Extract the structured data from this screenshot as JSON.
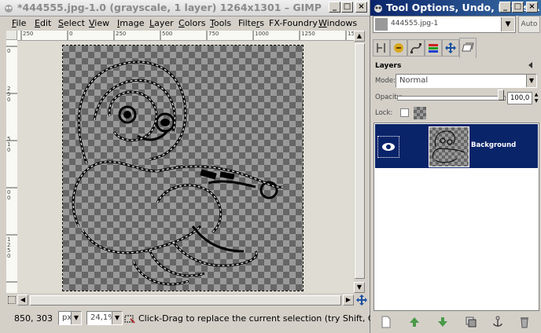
{
  "main_window": {
    "title": "*444555.jpg-1.0 (grayscale, 1 layer) 1264x1301 – GIMP",
    "title_buttons": [
      "_",
      "□",
      "×"
    ]
  },
  "menu": {
    "items": [
      {
        "label": "File",
        "mnemonic": "F"
      },
      {
        "label": "Edit",
        "mnemonic": "E"
      },
      {
        "label": "Select",
        "mnemonic": "S"
      },
      {
        "label": "View",
        "mnemonic": "V"
      },
      {
        "label": "Image",
        "mnemonic": "I"
      },
      {
        "label": "Layer",
        "mnemonic": "L"
      },
      {
        "label": "Colors",
        "mnemonic": "C"
      },
      {
        "label": "Tools",
        "mnemonic": "T"
      },
      {
        "label": "Filters",
        "mnemonic": "r"
      },
      {
        "label": "FX-Foundry",
        "mnemonic": ""
      },
      {
        "label": "Windows",
        "mnemonic": "W"
      }
    ]
  },
  "ruler": {
    "h_ticks": [
      "250",
      "0",
      "250",
      "500",
      "750",
      "1000",
      "1250",
      "1500"
    ],
    "v_ticks": [
      "0",
      "2",
      "5",
      "0",
      "5",
      "1",
      "0",
      "0",
      "0",
      "1",
      "2",
      "5",
      "0"
    ]
  },
  "statusbar": {
    "coords": "850, 303",
    "unit": "px",
    "zoom": "24,1%",
    "message": "Click-Drag to replace the current selection (try Shift, Ctrl, Alt)"
  },
  "dock": {
    "title": "Tool Options, Undo, Paths,...",
    "title_buttons": [
      "_",
      "□",
      "×"
    ],
    "image_select": "444555.jpg-1",
    "auto_label": "Auto",
    "tabs": [
      "tool-options",
      "device-status",
      "paths",
      "colors",
      "pointer",
      "layers"
    ],
    "layers": {
      "title": "Layers",
      "mode_label": "Mode:",
      "mode_value": "Normal",
      "opacity_label": "Opacity:",
      "opacity_value": "100,0",
      "lock_label": "Lock:",
      "layer_name": "Background"
    },
    "buttons": [
      "new-layer",
      "raise-layer",
      "lower-layer",
      "duplicate-layer",
      "anchor-layer",
      "delete-layer"
    ]
  },
  "colors": {
    "selection_row": "#0a246a",
    "dock_title_start": "#0a246a",
    "dock_title_end": "#3a6ea5",
    "checker_dark": "#666666",
    "checker_light": "#999999"
  }
}
